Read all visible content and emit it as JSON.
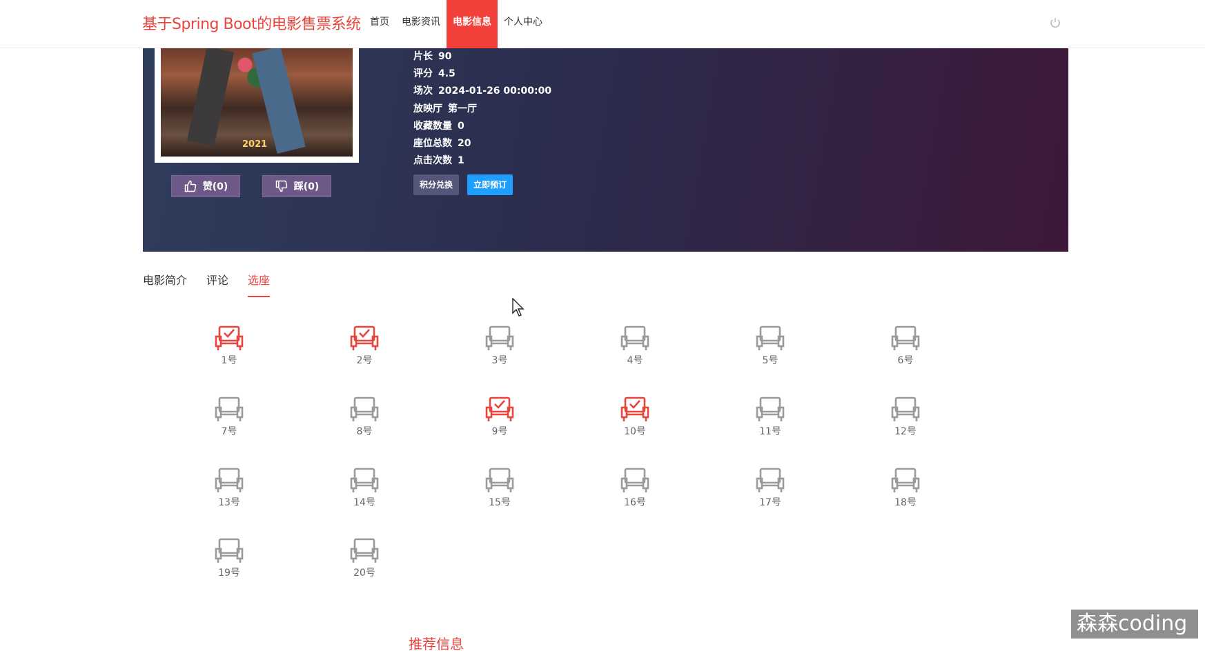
{
  "header": {
    "brand": "基于Spring Boot的电影售票系统",
    "nav": [
      {
        "label": "首页",
        "active": false
      },
      {
        "label": "电影资讯",
        "active": false
      },
      {
        "label": "电影信息",
        "active": true
      },
      {
        "label": "个人中心",
        "active": false
      }
    ],
    "power_icon": "power-icon"
  },
  "movie": {
    "poster_year": "2021",
    "like_label": "赞(0)",
    "dislike_label": "踩(0)",
    "info": [
      {
        "key": "片长",
        "value": "90"
      },
      {
        "key": "评分",
        "value": "4.5"
      },
      {
        "key": "场次",
        "value": "2024-01-26 00:00:00"
      },
      {
        "key": "放映厅",
        "value": "第一厅"
      },
      {
        "key": "收藏数量",
        "value": "0"
      },
      {
        "key": "座位总数",
        "value": "20"
      },
      {
        "key": "点击次数",
        "value": "1"
      }
    ],
    "exchange_label": "积分兑换",
    "book_label": "立即预订"
  },
  "tabs": [
    {
      "label": "电影简介",
      "active": false
    },
    {
      "label": "评论",
      "active": false
    },
    {
      "label": "选座",
      "active": true
    }
  ],
  "seats": [
    {
      "label": "1号",
      "selected": true
    },
    {
      "label": "2号",
      "selected": true
    },
    {
      "label": "3号",
      "selected": false
    },
    {
      "label": "4号",
      "selected": false
    },
    {
      "label": "5号",
      "selected": false
    },
    {
      "label": "6号",
      "selected": false
    },
    {
      "label": "7号",
      "selected": false
    },
    {
      "label": "8号",
      "selected": false
    },
    {
      "label": "9号",
      "selected": true
    },
    {
      "label": "10号",
      "selected": true
    },
    {
      "label": "11号",
      "selected": false
    },
    {
      "label": "12号",
      "selected": false
    },
    {
      "label": "13号",
      "selected": false
    },
    {
      "label": "14号",
      "selected": false
    },
    {
      "label": "15号",
      "selected": false
    },
    {
      "label": "16号",
      "selected": false
    },
    {
      "label": "17号",
      "selected": false
    },
    {
      "label": "18号",
      "selected": false
    },
    {
      "label": "19号",
      "selected": false
    },
    {
      "label": "20号",
      "selected": false
    }
  ],
  "recommend_title": "推荐信息",
  "watermark": "森森coding",
  "colors": {
    "accent": "#e8453c",
    "book": "#1e9fff",
    "seat_free": "#9a9a9a",
    "seat_selected": "#e8453c"
  }
}
